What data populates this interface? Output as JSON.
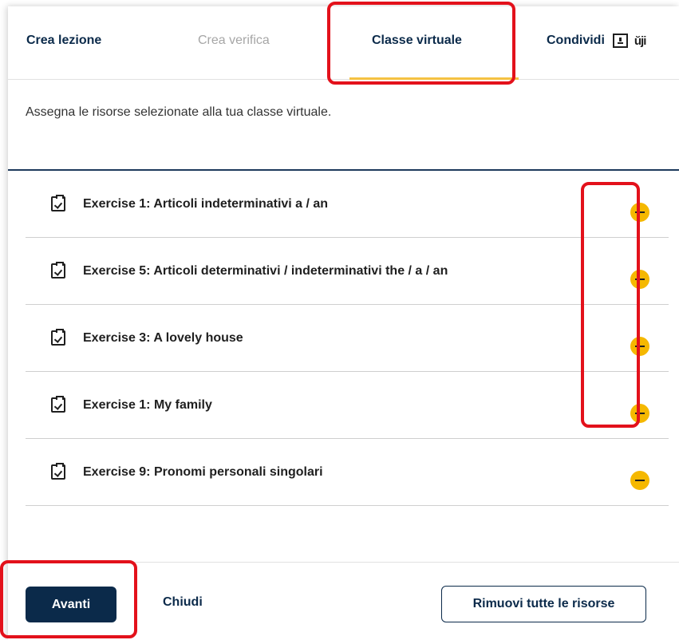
{
  "tabs": [
    {
      "label": "Crea lezione",
      "state": "enabled"
    },
    {
      "label": "Crea verifica",
      "state": "disabled"
    },
    {
      "label": "Classe virtuale",
      "state": "active"
    },
    {
      "label": "Condividi",
      "state": "enabled"
    }
  ],
  "description": "Assegna le risorse selezionate alla tua classe virtuale.",
  "resources": [
    {
      "title": "Exercise 1: Articoli indeterminativi a / an"
    },
    {
      "title": "Exercise 5: Articoli determinativi / indeterminativi the / a / an"
    },
    {
      "title": "Exercise 3: A lovely house"
    },
    {
      "title": "Exercise 1: My family"
    },
    {
      "title": "Exercise 9: Pronomi personali singolari"
    }
  ],
  "footer": {
    "primary_label": "Avanti",
    "close_label": "Chiudi",
    "remove_all_label": "Rimuovi tutte le risorse"
  },
  "icons": {
    "share": "share-screen-icon",
    "teams": "microsoft-teams-icon",
    "checklist": "clipboard-check-icon",
    "remove": "minus-circle-icon"
  },
  "colors": {
    "primary": "#0b2a4a",
    "accent": "#f5c242",
    "remove": "#f5b800",
    "highlight": "#e3111b"
  }
}
